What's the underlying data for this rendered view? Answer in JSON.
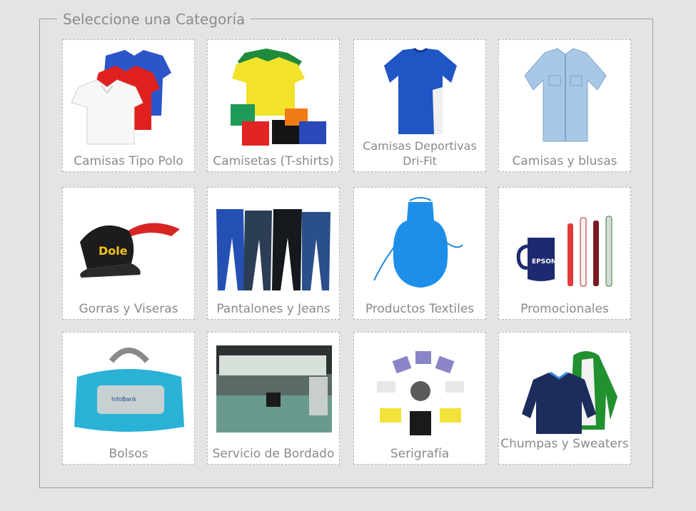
{
  "panel": {
    "title": "Seleccione una Categoría"
  },
  "categories": [
    {
      "label": "Camisas Tipo Polo",
      "icon": "polo-shirts-image"
    },
    {
      "label": "Camisetas (T-shirts)",
      "icon": "tshirts-image"
    },
    {
      "label": "Camisas Deportivas Dri-Fit",
      "icon": "sports-shirt-image"
    },
    {
      "label": "Camisas y blusas",
      "icon": "dress-shirt-image"
    },
    {
      "label": "Gorras y Viseras",
      "icon": "cap-visor-image"
    },
    {
      "label": "Pantalones y Jeans",
      "icon": "pants-image"
    },
    {
      "label": "Productos Textiles",
      "icon": "apron-image"
    },
    {
      "label": "Promocionales",
      "icon": "mug-pens-image"
    },
    {
      "label": "Bolsos",
      "icon": "duffel-bag-image"
    },
    {
      "label": "Servicio de Bordado",
      "icon": "embroidery-machine-image"
    },
    {
      "label": "Serigrafía",
      "icon": "screen-print-press-image"
    },
    {
      "label": "Chumpas y Sweaters",
      "icon": "jackets-image"
    }
  ],
  "product_text": {
    "cap_brand": "Dole",
    "mug_brand": "EPSON",
    "bag_brand": "InfoBank"
  }
}
